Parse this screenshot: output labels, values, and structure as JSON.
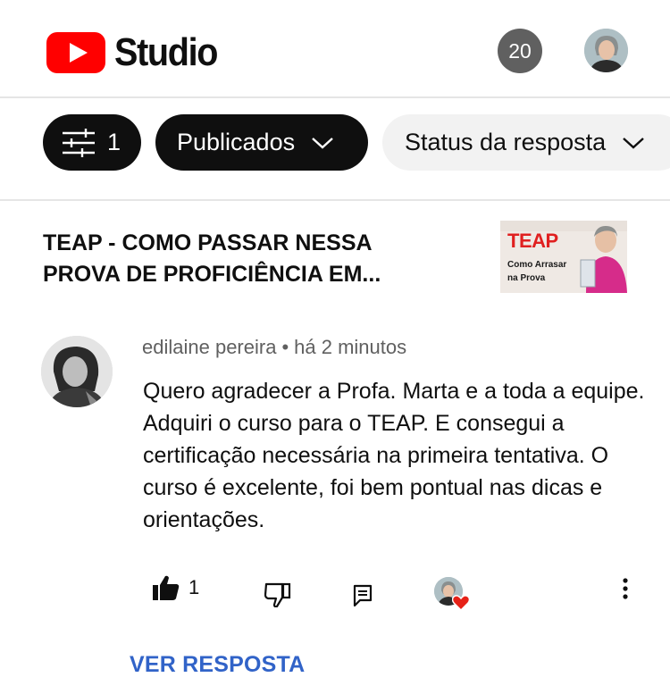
{
  "header": {
    "brand": "Studio",
    "notification_count": "20"
  },
  "filters": {
    "filter_count": "1",
    "published_label": "Publicados",
    "status_label": "Status da resposta"
  },
  "video": {
    "title": "TEAP - COMO PASSAR NESSA PROVA DE PROFICIÊNCIA EM...",
    "thumbnail_title": "TEAP",
    "thumbnail_subtitle": "Como Arrasar na Prova"
  },
  "comment": {
    "author": "edilaine pereira",
    "separator": "•",
    "time": "há 2 minutos",
    "text": "Quero agradecer a Profa. Marta  e a toda a equipe. Adquiri o curso para o TEAP. E consegui a certificação necessária na primeira tentativa. O curso é excelente, foi bem pontual nas dicas e orientações.",
    "like_count": "1",
    "view_reply_label": "VER RESPOSTA"
  },
  "icons": {
    "filter": "sliders-icon",
    "chevron": "chevron-down-icon",
    "like": "thumbs-up-icon",
    "dislike": "thumbs-down-icon",
    "reply": "reply-icon",
    "heart": "heart-icon",
    "more": "more-vert-icon"
  },
  "colors": {
    "brand_red": "#ff0000",
    "heart_red": "#e62117",
    "link_blue": "#3163c8",
    "chip_dark": "#0f0f0f",
    "chip_light": "#f2f2f2"
  }
}
